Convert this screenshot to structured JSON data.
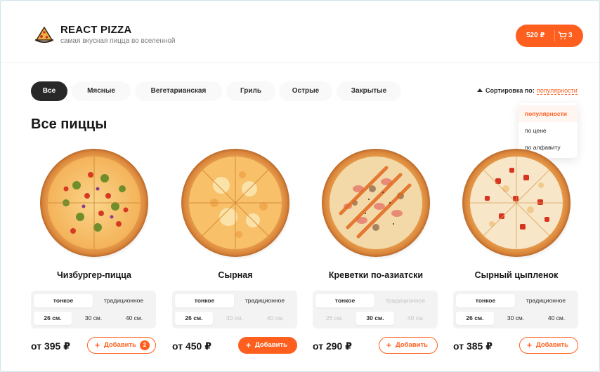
{
  "brand": {
    "title": "REACT PIZZA",
    "subtitle": "самая вкусная пицца во вселенной"
  },
  "cart": {
    "price": "520 ₽",
    "count": "3"
  },
  "categories": [
    "Все",
    "Мясные",
    "Вегетарианская",
    "Гриль",
    "Острые",
    "Закрытые"
  ],
  "sort": {
    "label": "Сортировка по:",
    "value": "популярности",
    "options": [
      "популярности",
      "по цене",
      "по алфавиту"
    ]
  },
  "page_title": "Все пиццы",
  "pizzas": [
    {
      "name": "Чизбургер-пицца",
      "doughs": [
        "тонкое",
        "традиционное"
      ],
      "sizes": [
        "26 см.",
        "30 см.",
        "40 см."
      ],
      "price": "от 395 ₽",
      "add_label": "Добавить",
      "add_count": "2"
    },
    {
      "name": "Сырная",
      "doughs": [
        "тонкое",
        "традиционное"
      ],
      "sizes": [
        "26 см.",
        "30 см.",
        "40 см."
      ],
      "price": "от 450 ₽",
      "add_label": "Добавить"
    },
    {
      "name": "Креветки по-азиатски",
      "doughs": [
        "тонкое",
        "традиционное"
      ],
      "sizes": [
        "26 см.",
        "30 см.",
        "40 см."
      ],
      "price": "от 290 ₽",
      "add_label": "Добавить"
    },
    {
      "name": "Сырный цыпленок",
      "doughs": [
        "тонкое",
        "традиционное"
      ],
      "sizes": [
        "26 см.",
        "30 см.",
        "40 см."
      ],
      "price": "от 385 ₽",
      "add_label": "Добавить"
    }
  ],
  "colors": {
    "accent": "#fe5f1e",
    "dark": "#282828"
  },
  "icons": {
    "logo": "pizza-slice-icon",
    "cart": "cart-icon",
    "sort_arrow": "caret-up-icon"
  }
}
